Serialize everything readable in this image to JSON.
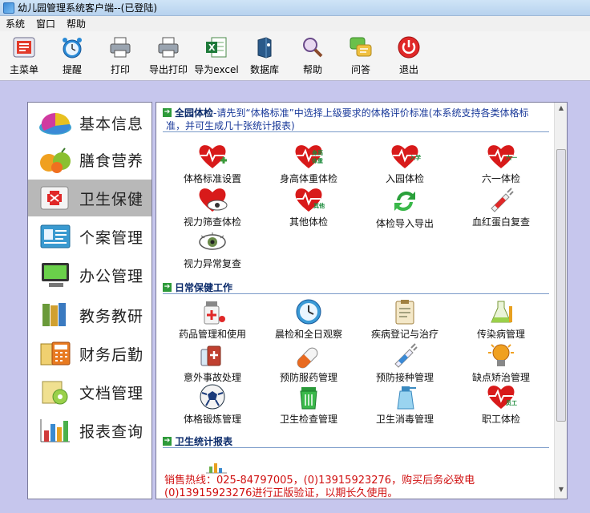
{
  "window": {
    "title": "幼儿园管理系统客户端--(已登陆)"
  },
  "menu": [
    "系统",
    "窗口",
    "帮助"
  ],
  "toolbar": [
    {
      "label": "主菜单",
      "icon": "main-menu-icon"
    },
    {
      "label": "提醒",
      "icon": "alarm-clock-icon"
    },
    {
      "label": "打印",
      "icon": "printer-icon"
    },
    {
      "label": "导出打印",
      "icon": "export-print-icon"
    },
    {
      "label": "导为excel",
      "icon": "excel-icon"
    },
    {
      "label": "数据库",
      "icon": "database-icon"
    },
    {
      "label": "帮助",
      "icon": "help-icon"
    },
    {
      "label": "问答",
      "icon": "qa-icon"
    },
    {
      "label": "退出",
      "icon": "power-icon"
    }
  ],
  "sidebar": {
    "items": [
      {
        "label": "基本信息",
        "icon": "pie-chart-icon"
      },
      {
        "label": "膳食营养",
        "icon": "fruit-icon"
      },
      {
        "label": "卫生保健",
        "icon": "first-aid-icon"
      },
      {
        "label": "个案管理",
        "icon": "contact-card-icon"
      },
      {
        "label": "办公管理",
        "icon": "monitor-icon"
      },
      {
        "label": "教务教研",
        "icon": "books-icon"
      },
      {
        "label": "财务后勤",
        "icon": "calculator-icon"
      },
      {
        "label": "文档管理",
        "icon": "documents-icon"
      },
      {
        "label": "报表查询",
        "icon": "bar-chart-icon"
      }
    ],
    "active": "卫生保健"
  },
  "sections": {
    "physical": {
      "title": "全园体检",
      "note": "-请先到“体格标准”中选择上级要求的体格评价标准(本系统支持各类体格标",
      "note2": "准，并可生成几十张统计报表)",
      "items": [
        {
          "label": "体格标准设置",
          "tag": ""
        },
        {
          "label": "身高体重体检",
          "tag": "身高体重"
        },
        {
          "label": "入园体检",
          "tag": "入学"
        },
        {
          "label": "六一体检",
          "tag": "六一"
        },
        {
          "label": "视力筛查体检",
          "tag": ""
        },
        {
          "label": "其他体检",
          "tag": "其他"
        },
        {
          "label": "体检导入导出",
          "tag": ""
        },
        {
          "label": "血红蛋白复查",
          "tag": ""
        },
        {
          "label": "视力异常复查",
          "tag": ""
        }
      ]
    },
    "daily": {
      "title": "日常保健工作",
      "items": [
        {
          "label": "药品管理和使用"
        },
        {
          "label": "晨检和全日观察"
        },
        {
          "label": "疾病登记与治疗"
        },
        {
          "label": "传染病管理"
        },
        {
          "label": "意外事故处理"
        },
        {
          "label": "预防服药管理"
        },
        {
          "label": "预防接种管理"
        },
        {
          "label": "缺点矫治管理"
        },
        {
          "label": "体格锻炼管理"
        },
        {
          "label": "卫生检查管理"
        },
        {
          "label": "卫生消毒管理"
        },
        {
          "label": "职工体检",
          "tag": "员工"
        }
      ]
    },
    "stats": {
      "title": "卫生统计报表"
    }
  },
  "footer": {
    "line1": "销售热线：025-84797005，(0)13915923276，购买后务必致电",
    "line2": "(0)13915923276进行正版验证，以期长久使用。"
  },
  "colors": {
    "background": "#c6c6ed",
    "heart": "#d01818",
    "section_title": "#0a2a6a",
    "footer_text": "#d01010"
  }
}
